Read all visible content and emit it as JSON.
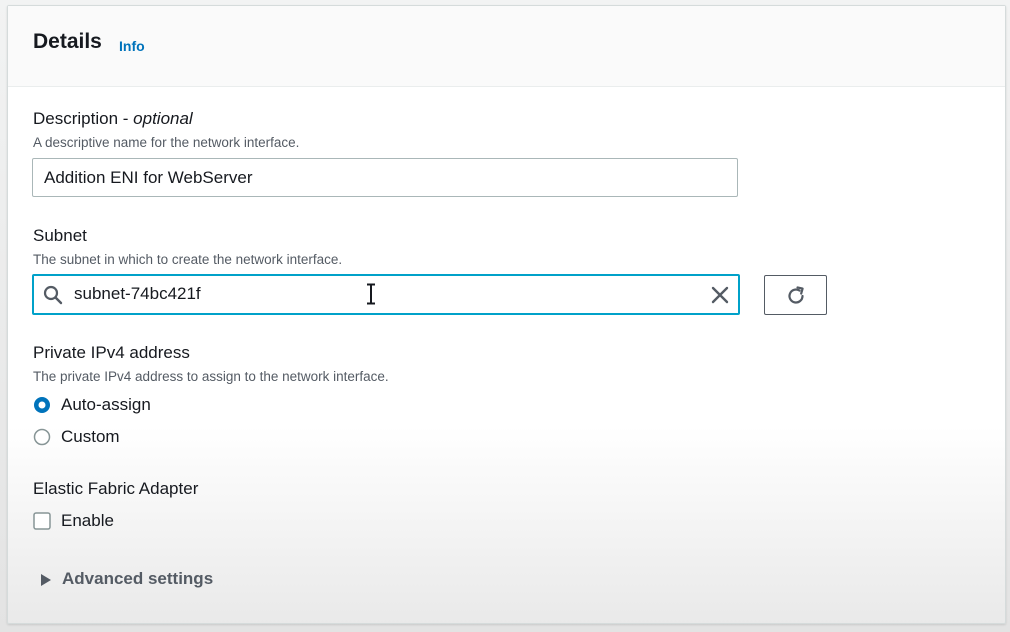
{
  "panel": {
    "title": "Details",
    "info_link": "Info"
  },
  "description": {
    "label": "Description -",
    "label_optional": "optional",
    "help": "A descriptive name for the network interface.",
    "value": "Addition ENI for WebServer"
  },
  "subnet": {
    "label": "Subnet",
    "help": "The subnet in which to create the network interface.",
    "value": "subnet-74bc421f"
  },
  "private_ip": {
    "label": "Private IPv4 address",
    "help": "The private IPv4 address to assign to the network interface.",
    "options": [
      {
        "label": "Auto-assign",
        "selected": true
      },
      {
        "label": "Custom",
        "selected": false
      }
    ]
  },
  "efa": {
    "label": "Elastic Fabric Adapter",
    "checkbox_label": "Enable",
    "checked": false
  },
  "advanced": {
    "label": "Advanced settings"
  },
  "colors": {
    "accent": "#0073bb",
    "focus": "#00a1c9",
    "radio_selected": "#0073bb"
  },
  "icons": [
    "search-icon",
    "clear-icon",
    "refresh-icon",
    "caret-right-icon",
    "text-cursor-icon"
  ]
}
